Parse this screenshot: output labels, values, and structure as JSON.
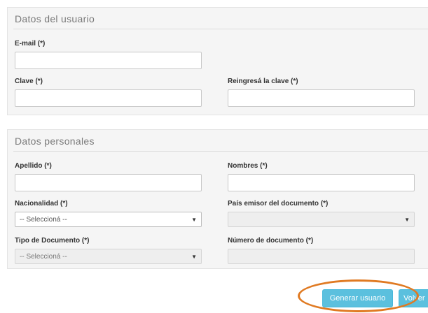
{
  "user_section": {
    "title": "Datos del usuario",
    "email_label": "E-mail (*)",
    "email_value": "",
    "password_label": "Clave (*)",
    "password_value": "",
    "password_repeat_label": "Reingresá la clave (*)",
    "password_repeat_value": ""
  },
  "personal_section": {
    "title": "Datos personales",
    "surname_label": "Apellido (*)",
    "surname_value": "",
    "names_label": "Nombres (*)",
    "names_value": "",
    "nationality_label": "Nacionalidad (*)",
    "nationality_selected": "-- Seleccioná --",
    "issuing_country_label": "País emisor del documento (*)",
    "issuing_country_selected": "",
    "doc_type_label": "Tipo de Documento (*)",
    "doc_type_selected": "-- Seleccioná --",
    "doc_number_label": "Número de documento (*)",
    "doc_number_value": ""
  },
  "actions": {
    "generate_label": "Generar usuario",
    "back_label": "Volver"
  },
  "icons": {
    "select_arrow": "chevron-down-icon"
  },
  "colors": {
    "button": "#5bc0de",
    "highlight": "#e07a22",
    "panel": "#f5f5f5"
  }
}
